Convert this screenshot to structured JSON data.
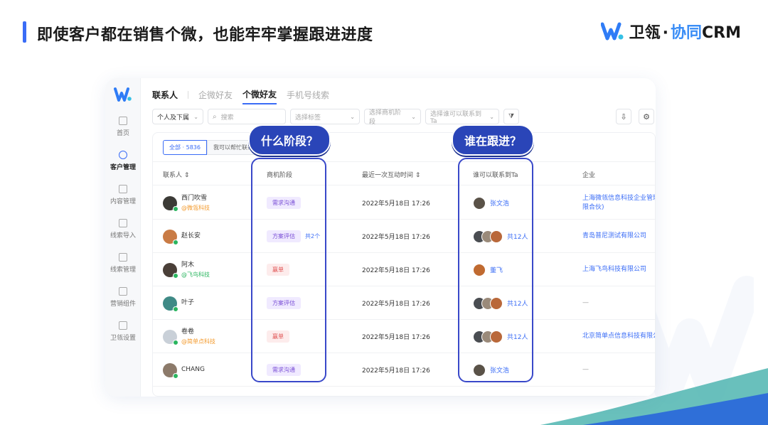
{
  "header": {
    "headline": "即使客户都在销售个微，也能牢牢掌握跟进进度"
  },
  "brand": {
    "name_part1": "卫瓴",
    "dot": "·",
    "name_part2": "协同",
    "name_part3": "CRM"
  },
  "colors": {
    "accent": "#3a6cf6",
    "highlight": "#3948c9",
    "pill": "#2a45b8"
  },
  "sidebar": {
    "items": [
      {
        "label": "首页",
        "icon": "home-icon"
      },
      {
        "label": "客户管理",
        "icon": "customer-icon",
        "active": true
      },
      {
        "label": "内容管理",
        "icon": "content-icon"
      },
      {
        "label": "线索导入",
        "icon": "import-icon"
      },
      {
        "label": "线索管理",
        "icon": "leads-icon"
      },
      {
        "label": "营销组件",
        "icon": "folder-icon"
      },
      {
        "label": "卫瓴设置",
        "icon": "settings-icon"
      }
    ]
  },
  "tabs": [
    "联系人",
    "企微好友",
    "个微好友",
    "手机号线索"
  ],
  "filters": {
    "scope": "个人及下属",
    "search_placeholder": "搜索",
    "tag_placeholder": "选择标签",
    "stage_placeholder": "选择商机阶段",
    "contact_placeholder": "选择谁可以联系到Ta"
  },
  "segments": {
    "all": "全部 · 5836",
    "help": "我可以帮忙联系"
  },
  "columns": {
    "contact": "联系人",
    "stage": "商机阶段",
    "last": "最近一次互动时间",
    "who": "谁可以联系到Ta",
    "company": "企业"
  },
  "rows": [
    {
      "name": "西门吹雪",
      "sub": "@微瓴科技",
      "stage": "需求沟通",
      "time": "2022年5月18日 17:26",
      "who": "张文浩",
      "company": "上海微瓴信息科技企业管理",
      "company2": "限合伙)"
    },
    {
      "name": "赵长安",
      "sub": "",
      "stage": "方案评估",
      "stage_extra": "共2个",
      "time": "2022年5月18日 17:26",
      "who": "共12人",
      "company": "青岛普尼测试有限公司",
      "company2": ""
    },
    {
      "name": "阿木",
      "sub": "@飞鸟科技",
      "stage": "赢单",
      "time": "2022年5月18日 17:26",
      "who": "董飞",
      "company": "上海飞鸟科技有限公司",
      "company2": ""
    },
    {
      "name": "叶子",
      "sub": "",
      "stage": "方案评估",
      "time": "2022年5月18日 17:26",
      "who": "共12人",
      "company": "—",
      "company2": ""
    },
    {
      "name": "卷卷",
      "sub": "@简单点科技",
      "stage": "赢单",
      "time": "2022年5月18日 17:26",
      "who": "共12人",
      "company": "北京简单点信息科技有限公",
      "company2": ""
    },
    {
      "name": "CHANG",
      "sub": "",
      "stage": "需求沟通",
      "time": "2022年5月18日 17:26",
      "who": "张文浩",
      "company": "—",
      "company2": ""
    }
  ],
  "callouts": {
    "stage": "什么阶段？",
    "who": "谁在跟进？"
  }
}
